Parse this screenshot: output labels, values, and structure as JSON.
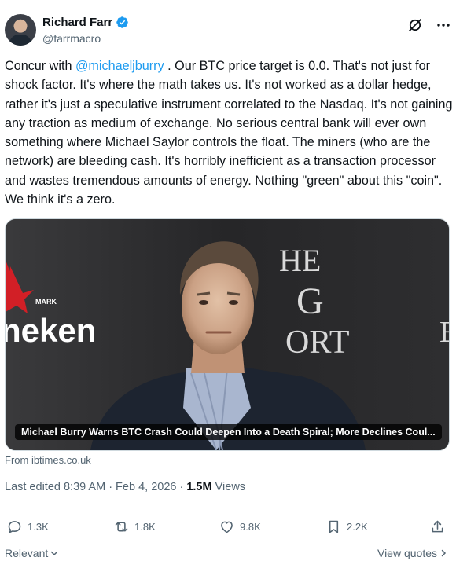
{
  "author": {
    "display_name": "Richard Farr",
    "handle": "@farrmacro",
    "verified": true
  },
  "tweet": {
    "text_pre": "Concur with ",
    "mention": "@michaeljburry",
    "text_post": " .  Our BTC price target is 0.0.  That's not just for shock factor.  It's where the math takes us.  It's not worked as a dollar hedge, rather it's just a speculative instrument correlated to the Nasdaq.  It's not gaining any traction as medium of exchange.  No serious central bank will ever own something where Michael Saylor controls the float.  The miners (who are the network) are bleeding cash.  It's horribly inefficient as a transaction processor and wastes tremendous amounts of energy.  Nothing \"green\" about this \"coin\".  We think it's a zero."
  },
  "media": {
    "caption": "Michael Burry Warns BTC Crash Could Deepen Into a Death Spiral; More Declines Coul...",
    "source": "From ibtimes.co.uk",
    "backdrop_left": "neken",
    "backdrop_mark": "MARK",
    "backdrop_right_lines": [
      "HE",
      "G",
      "ORT"
    ],
    "backdrop_far_right": "E"
  },
  "meta": {
    "edited": "Last edited 8:39 AM · Feb 4, 2026 · ",
    "views_count": "1.5M",
    "views_label": " Views"
  },
  "actions": {
    "replies": "1.3K",
    "reposts": "1.8K",
    "likes": "9.8K",
    "bookmarks": "2.2K"
  },
  "footer": {
    "sort_label": "Relevant",
    "quotes_label": "View quotes"
  },
  "colors": {
    "accent": "#1d9bf0",
    "text": "#0f1419",
    "secondary": "#536471"
  }
}
